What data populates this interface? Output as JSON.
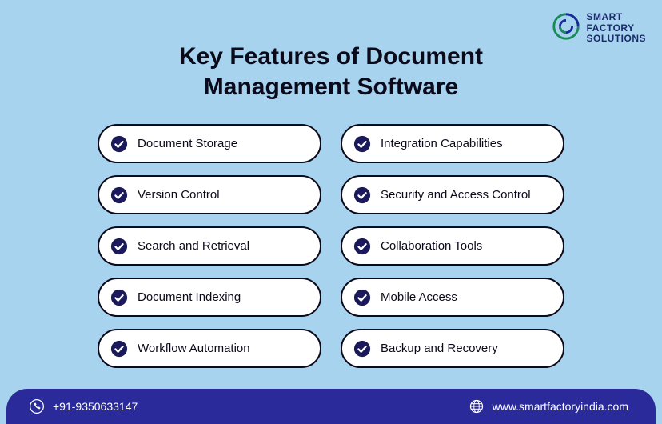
{
  "brand": {
    "line1": "SMART",
    "line2": "FACTORY",
    "line3": "SOLUTIONS"
  },
  "title_line1": "Key Features of Document",
  "title_line2": "Management Software",
  "features": {
    "left": [
      "Document Storage",
      "Version Control",
      "Search and Retrieval",
      "Document Indexing",
      "Workflow Automation"
    ],
    "right": [
      "Integration Capabilities",
      "Security and Access Control",
      "Collaboration Tools",
      "Mobile Access",
      "Backup and Recovery"
    ]
  },
  "footer": {
    "phone": "+91-9350633147",
    "website": "www.smartfactoryindia.com"
  }
}
